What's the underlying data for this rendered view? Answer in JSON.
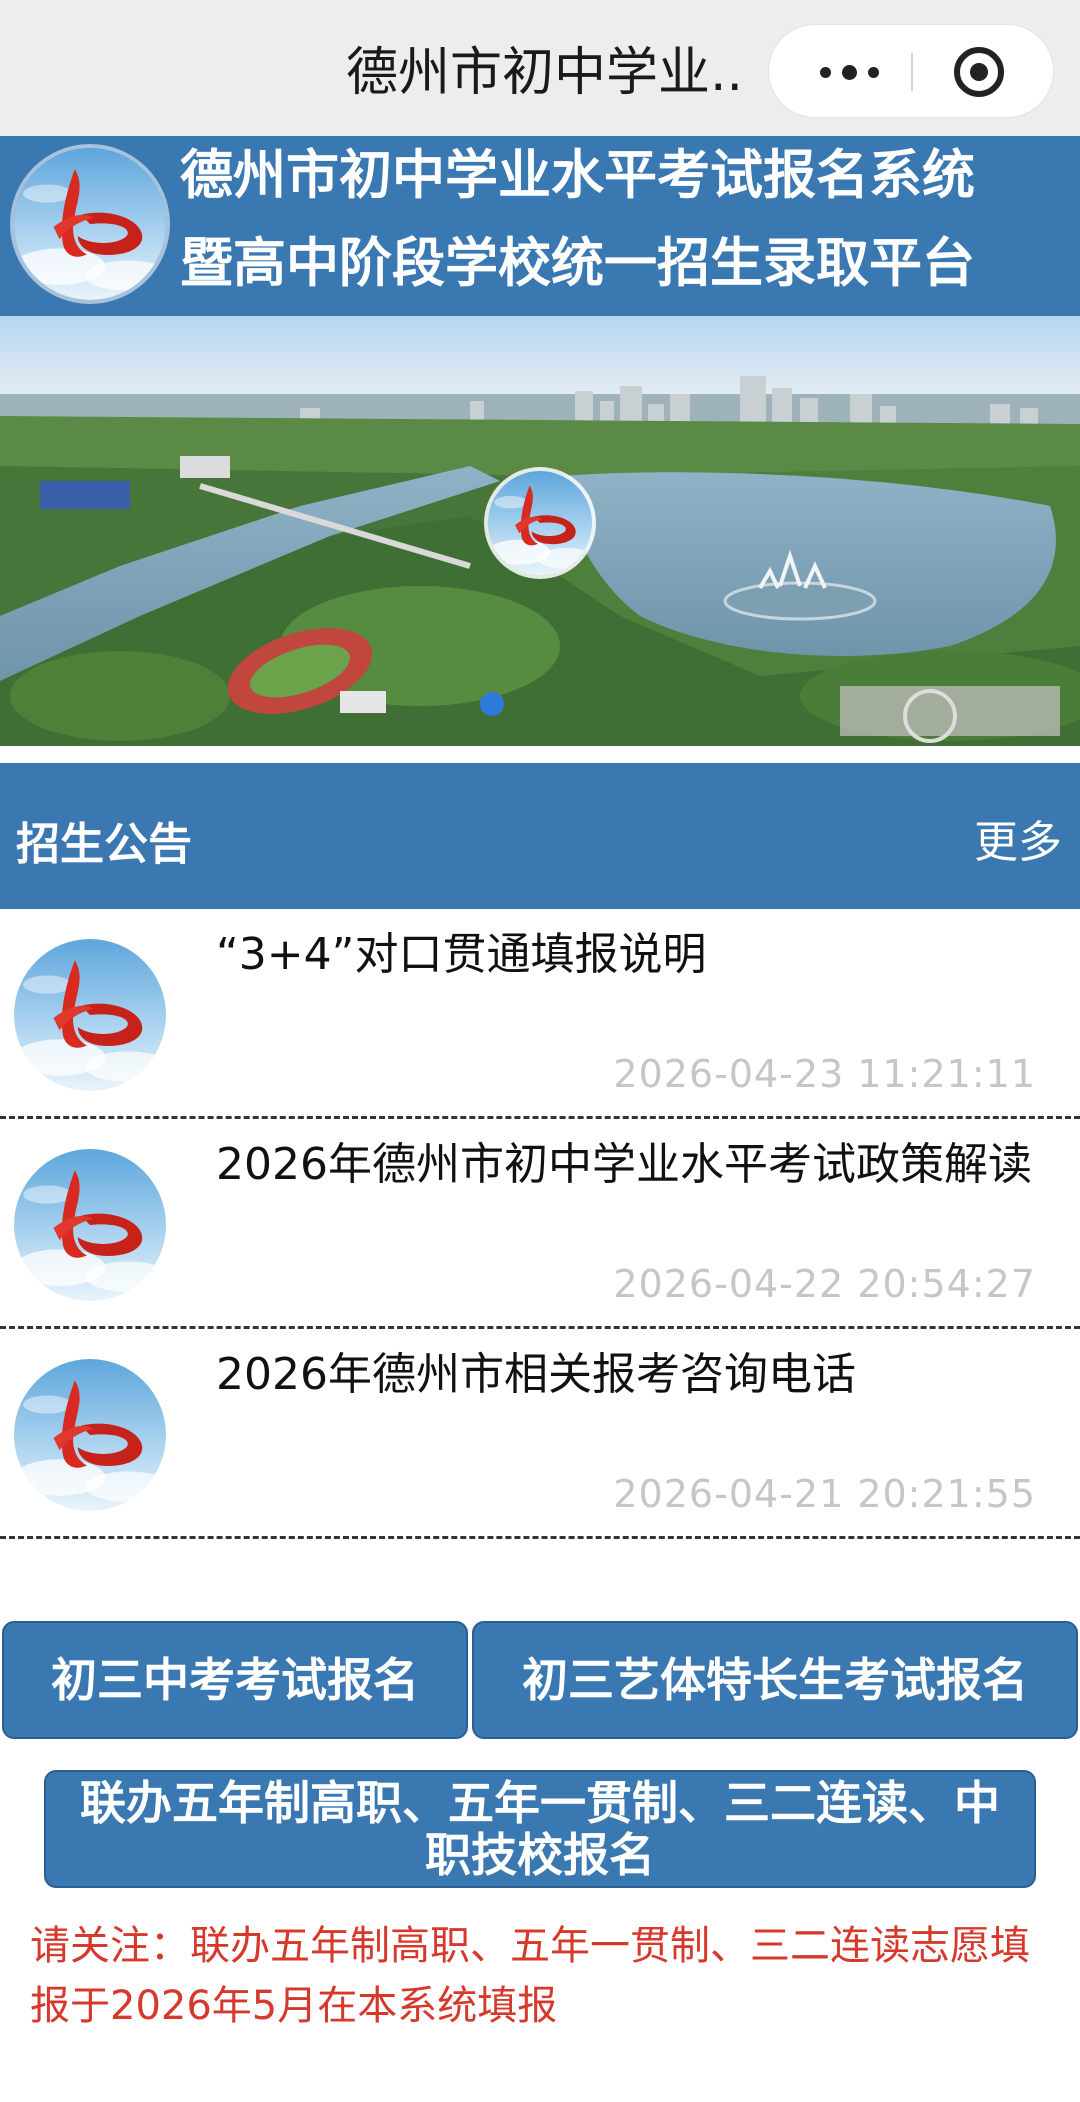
{
  "topbar": {
    "title": "德州市初中学业..."
  },
  "header": {
    "line1": "德州市初中学业水平考试报名系统",
    "line2": "暨高中阶段学校统一招生录取平台"
  },
  "section": {
    "title": "招生公告",
    "more_label": "更多"
  },
  "notices": [
    {
      "title": "“3+4”对口贯通填报说明",
      "date": "2026-04-23 11:21:11"
    },
    {
      "title": "2026年德州市初中学业水平考试政策解读",
      "date": "2026-04-22 20:54:27"
    },
    {
      "title": "2026年德州市相关报考咨询电话",
      "date": "2026-04-21 20:21:55"
    }
  ],
  "buttons": {
    "exam_registration": "初三中考考试报名",
    "art_sports_registration": "初三艺体特长生考试报名",
    "vocational_registration": "联办五年制高职、五年一贯制、三二连读、中职技校报名"
  },
  "footer_note": "请关注：联办五年制高职、五年一贯制、三二连读志愿填报于2026年5月在本系统填报",
  "carousel": {
    "active_index": 0,
    "slides": 1
  },
  "colors": {
    "brand_blue": "#3a78b2",
    "topbar_bg": "#ededed",
    "date_gray": "#c6c6c6",
    "note_red": "#d6392b",
    "logo_red": "#d82a20"
  },
  "icons": [
    "more-dots-icon",
    "close-target-icon",
    "site-logo"
  ]
}
